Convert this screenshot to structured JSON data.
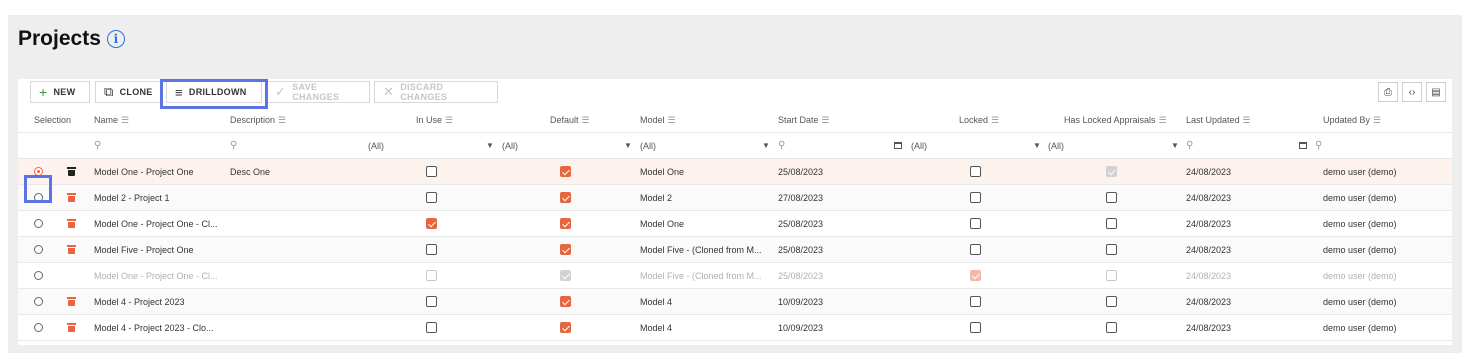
{
  "page": {
    "title": "Projects",
    "info_icon": "info-icon"
  },
  "toolbar": {
    "new_label": "NEW",
    "clone_label": "CLONE",
    "drilldown_label": "DRILLDOWN",
    "save_label": "SAVE CHANGES",
    "discard_label": "DISCARD CHANGES",
    "export_icons": [
      "print-icon",
      "code-export-icon",
      "file-export-icon"
    ]
  },
  "columns": {
    "selection": "Selection",
    "name": "Name",
    "description": "Description",
    "in_use": "In Use",
    "default": "Default",
    "model": "Model",
    "start_date": "Start Date",
    "locked": "Locked",
    "has_locked_appraisals": "Has Locked Appraisals",
    "last_updated": "Last Updated",
    "updated_by": "Updated By"
  },
  "filters": {
    "in_use": "(All)",
    "default": "(All)",
    "model": "(All)",
    "locked": "(All)",
    "has_locked_appraisals": "(All)"
  },
  "rows": [
    {
      "selected": true,
      "deletable": true,
      "name": "Model One - Project One",
      "description": "Desc One",
      "in_use": false,
      "default": true,
      "model": "Model One",
      "start_date": "25/08/2023",
      "locked": false,
      "has_locked_appraisals": true,
      "last_updated": "24/08/2023",
      "updated_by": "demo user (demo)"
    },
    {
      "selected": false,
      "deletable": true,
      "name": "Model 2 - Project 1",
      "description": "",
      "in_use": false,
      "default": true,
      "model": "Model 2",
      "start_date": "27/08/2023",
      "locked": false,
      "has_locked_appraisals": false,
      "last_updated": "24/08/2023",
      "updated_by": "demo user (demo)"
    },
    {
      "selected": false,
      "deletable": true,
      "name": "Model One - Project One - Cl...",
      "description": "",
      "in_use": true,
      "default": true,
      "model": "Model One",
      "start_date": "25/08/2023",
      "locked": false,
      "has_locked_appraisals": false,
      "last_updated": "24/08/2023",
      "updated_by": "demo user (demo)"
    },
    {
      "selected": false,
      "deletable": true,
      "name": "Model Five - Project One",
      "description": "",
      "in_use": false,
      "default": true,
      "model": "Model Five - (Cloned from M...",
      "start_date": "25/08/2023",
      "locked": false,
      "has_locked_appraisals": false,
      "last_updated": "24/08/2023",
      "updated_by": "demo user (demo)"
    },
    {
      "selected": false,
      "deletable": false,
      "name": "Model One - Project One - Cl...",
      "description": "",
      "in_use": false,
      "default": true,
      "model": "Model Five - (Cloned from M...",
      "start_date": "25/08/2023",
      "locked": true,
      "has_locked_appraisals": false,
      "last_updated": "24/08/2023",
      "updated_by": "demo user (demo)"
    },
    {
      "selected": false,
      "deletable": true,
      "name": "Model 4 - Project 2023",
      "description": "",
      "in_use": false,
      "default": true,
      "model": "Model 4",
      "start_date": "10/09/2023",
      "locked": false,
      "has_locked_appraisals": false,
      "last_updated": "24/08/2023",
      "updated_by": "demo user (demo)"
    },
    {
      "selected": false,
      "deletable": true,
      "name": "Model 4 - Project 2023 - Clo...",
      "description": "",
      "in_use": false,
      "default": true,
      "model": "Model 4",
      "start_date": "10/09/2023",
      "locked": false,
      "has_locked_appraisals": false,
      "last_updated": "24/08/2023",
      "updated_by": "demo user (demo)"
    }
  ],
  "colors": {
    "accent": "#e8663f",
    "highlight": "#5c73e6",
    "info": "#2f6fe0"
  }
}
